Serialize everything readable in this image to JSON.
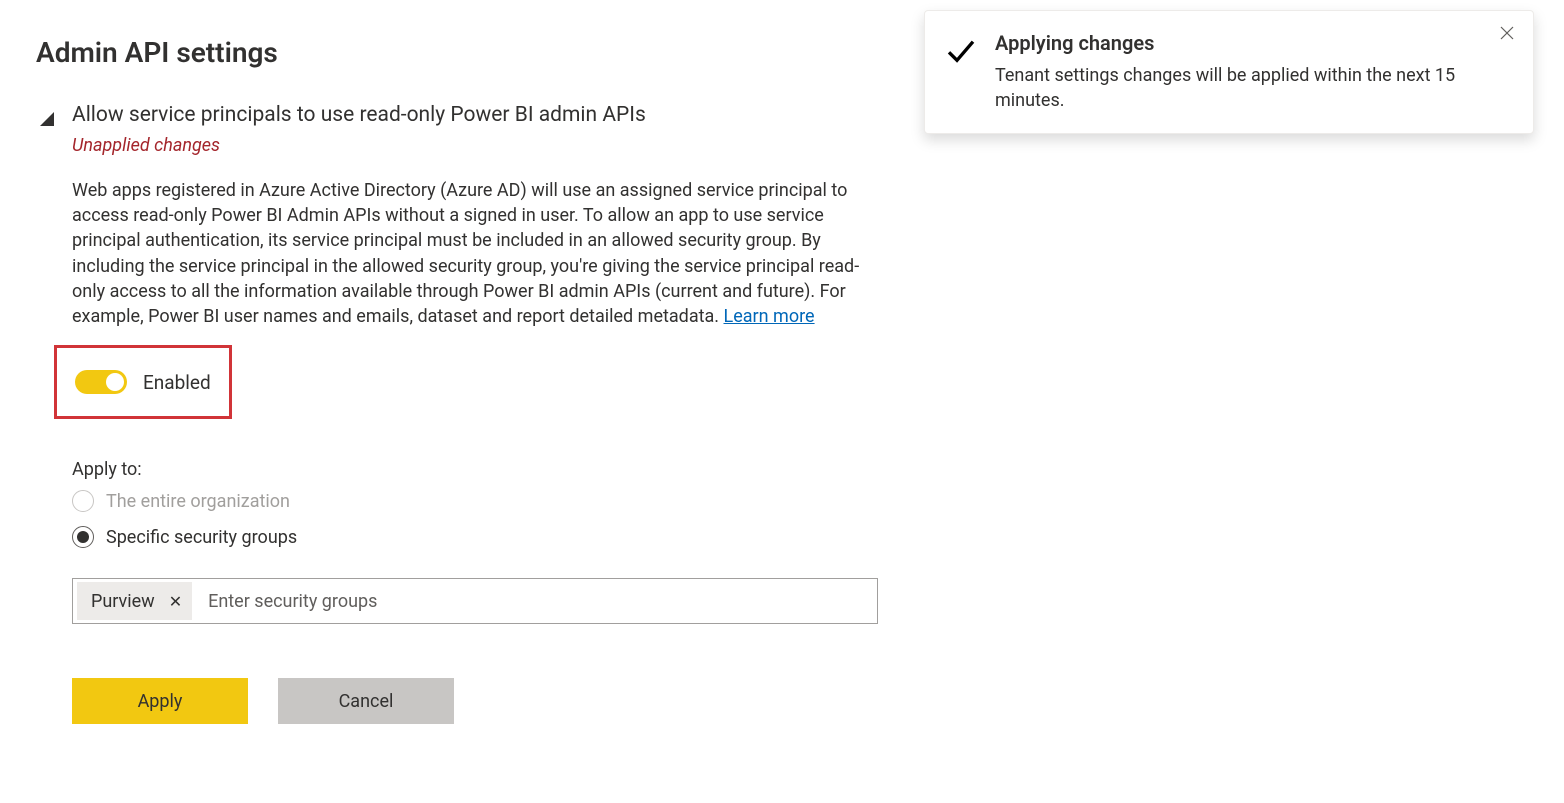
{
  "header": {
    "title": "Admin API settings"
  },
  "setting": {
    "title": "Allow service principals to use read-only Power BI admin APIs",
    "unapplied_label": "Unapplied changes",
    "description": "Web apps registered in Azure Active Directory (Azure AD) will use an assigned service principal to access read-only Power BI Admin APIs without a signed in user. To allow an app to use service principal authentication, its service principal must be included in an allowed security group. By including the service principal in the allowed security group, you're giving the service principal read-only access to all the information available through Power BI admin APIs (current and future). For example, Power BI user names and emails, dataset and report detailed metadata. ",
    "learn_more_label": "Learn more",
    "toggle": {
      "enabled": true,
      "label": "Enabled"
    },
    "apply_to": {
      "label": "Apply to:",
      "options": {
        "entire_org": "The entire organization",
        "specific_groups": "Specific security groups"
      },
      "selected": "specific_groups"
    },
    "security_groups": {
      "chips": [
        "Purview"
      ],
      "placeholder": "Enter security groups"
    },
    "buttons": {
      "apply": "Apply",
      "cancel": "Cancel"
    }
  },
  "toast": {
    "title": "Applying changes",
    "message": "Tenant settings changes will be applied within the next 15 minutes."
  }
}
